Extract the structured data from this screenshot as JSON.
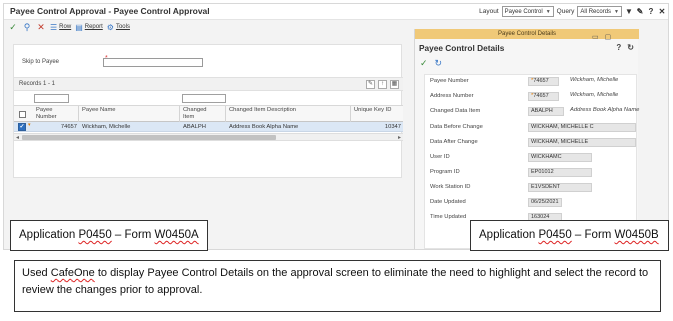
{
  "window": {
    "title": "Payee Control Approval - Payee Control Approval",
    "layout_label": "Layout",
    "layout_value": "Payee Control",
    "query_label": "Query",
    "query_value": "All Records"
  },
  "toolbar": {
    "row_label": "Row",
    "report_label": "Report",
    "tools_label": "Tools"
  },
  "filter": {
    "skip_label": "Skip to Payee",
    "skip_value": ""
  },
  "grid": {
    "records_label": "Records 1 - 1",
    "columns": [
      "Payee Number",
      "Payee Name",
      "Changed Item",
      "Changed Item Description",
      "Unique Key ID"
    ],
    "rows": [
      {
        "payee_number": "74657",
        "payee_name": "Wickham, Michelle",
        "changed_item": "ABALPH",
        "changed_item_description": "Address Book Alpha Name",
        "unique_key_id": "10347"
      }
    ]
  },
  "details": {
    "band_label": "Payee Control Details",
    "title": "Payee Control Details",
    "fields": [
      {
        "label": "Payee Number",
        "value": "74657",
        "desc": "Wickham, Michelle"
      },
      {
        "label": "Address Number",
        "value": "74657",
        "desc": "Wickham, Michelle"
      },
      {
        "label": "Changed Data Item",
        "value": "ABALPH",
        "desc": "Address Book Alpha Name"
      },
      {
        "label": "Data Before Change",
        "value": "WICKHAM, MICHELLE C",
        "desc": ""
      },
      {
        "label": "Data After Change",
        "value": "WICKHAM, MICHELLE",
        "desc": ""
      },
      {
        "label": "User ID",
        "value": "WICKHAMC",
        "desc": ""
      },
      {
        "label": "Program ID",
        "value": "EP01012",
        "desc": ""
      },
      {
        "label": "Work Station ID",
        "value": "E1VSDENT",
        "desc": ""
      },
      {
        "label": "Date Updated",
        "value": "06/25/2021",
        "desc": ""
      },
      {
        "label": "Time Updated",
        "value": "163024",
        "desc": ""
      }
    ]
  },
  "captions": {
    "left": {
      "prefix": "Application ",
      "app": "P0450",
      "mid": " – Form ",
      "form": "W0450A"
    },
    "right": {
      "prefix": "Application ",
      "app": "P0450",
      "mid": " – Form ",
      "form": "W0450B"
    },
    "note": {
      "pre": "Used ",
      "brand": "CafeOne",
      "post": " to display Payee Control Details on the approval screen to eliminate the need to highlight and select the record to review the changes prior to approval."
    }
  },
  "icons": {
    "ok": "check-icon",
    "search": "search-icon",
    "cancel": "close-icon",
    "filter": "filter-icon",
    "edit": "pencil-icon",
    "help": "help-icon",
    "close": "close-icon",
    "refresh": "refresh-icon"
  }
}
